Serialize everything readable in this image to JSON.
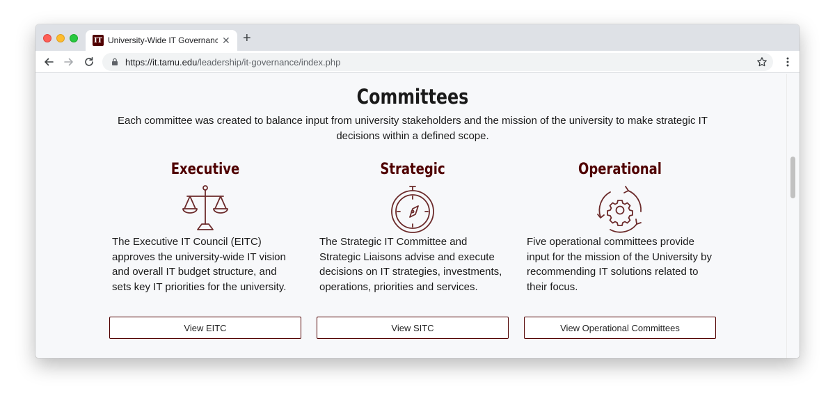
{
  "browser": {
    "tab_title": "University-Wide IT Governance",
    "favicon_text": "IT",
    "url_host": "https://it.tamu.edu",
    "url_path": "/leadership/it-governance/index.php"
  },
  "page": {
    "heading": "Committees",
    "intro": "Each committee was created to balance input from university stakeholders and the mission of the university to make strategic IT decisions within a defined scope.",
    "columns": [
      {
        "title": "Executive",
        "icon": "scales-icon",
        "text": "The Executive IT Council (EITC) approves the university-wide IT vision and overall IT budget structure, and sets key IT priorities for the university.",
        "button": "View EITC"
      },
      {
        "title": "Strategic",
        "icon": "compass-icon",
        "text": "The Strategic IT Committee and Strategic Liaisons advise and execute decisions on IT strategies, investments, operations, priorities and services.",
        "button": "View SITC"
      },
      {
        "title": "Operational",
        "icon": "gear-cycle-icon",
        "text": "Five operational committees provide input for the mission of the University by recommending IT solutions related to their focus.",
        "button": "View Operational Committees"
      }
    ]
  },
  "colors": {
    "maroon": "#500000",
    "text": "#1a1a1a",
    "background": "#f7f8fa"
  }
}
